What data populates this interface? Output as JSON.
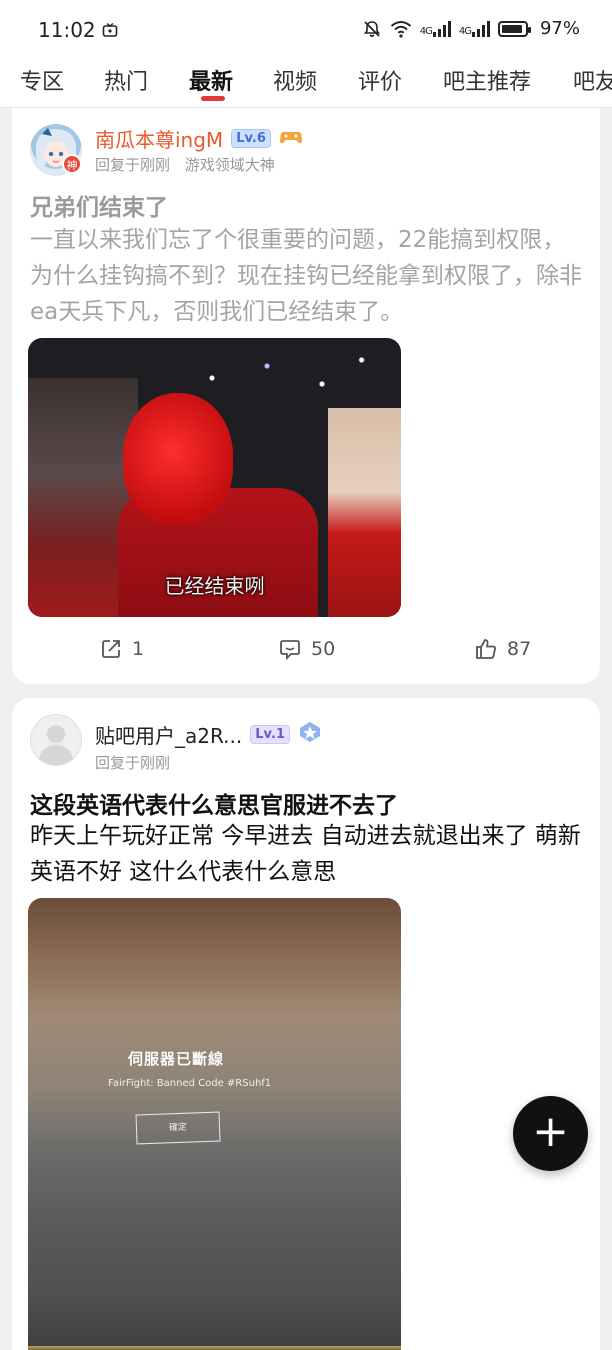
{
  "status_bar": {
    "time": "11:02",
    "battery": "97%",
    "signal_1": "4G",
    "signal_2": "4G"
  },
  "tabs": [
    {
      "label": "专区"
    },
    {
      "label": "热门"
    },
    {
      "label": "最新",
      "active": true
    },
    {
      "label": "视频"
    },
    {
      "label": "评价"
    },
    {
      "label": "吧主推荐"
    },
    {
      "label": "吧友"
    }
  ],
  "posts": [
    {
      "author": "南瓜本尊ingM",
      "level": "Lv.6",
      "avatar_badge": "神",
      "reply_info": "回复于刚刚",
      "author_title": "游戏领域大神",
      "title": "兄弟们结束了",
      "body": "一直以来我们忘了个很重要的问题，22能搞到权限，为什么挂钩搞不到？现在挂钩已经能拿到权限了，除非ea天兵下凡，否则我们已经结束了。",
      "image_caption": "已经结束咧",
      "shares": "1",
      "comments": "50",
      "likes": "87"
    },
    {
      "author": "贴吧用户_a2R...",
      "level": "Lv.1",
      "reply_info": "回复于刚刚",
      "title": "这段英语代表什么意思官服进不去了",
      "body": "昨天上午玩好正常 今早进去 自动进去就退出来了 萌新英语不好 这什么代表什么意思",
      "image_dialog_title": "伺服器已斷線",
      "image_dialog_code": "FairFight: Banned Code #RSuhf1",
      "image_dialog_button": "確定"
    }
  ],
  "fab": {
    "label": "+"
  },
  "colors": {
    "accent": "#e23a3a",
    "username_orange": "#ea5a2e",
    "background": "#efeff2"
  }
}
